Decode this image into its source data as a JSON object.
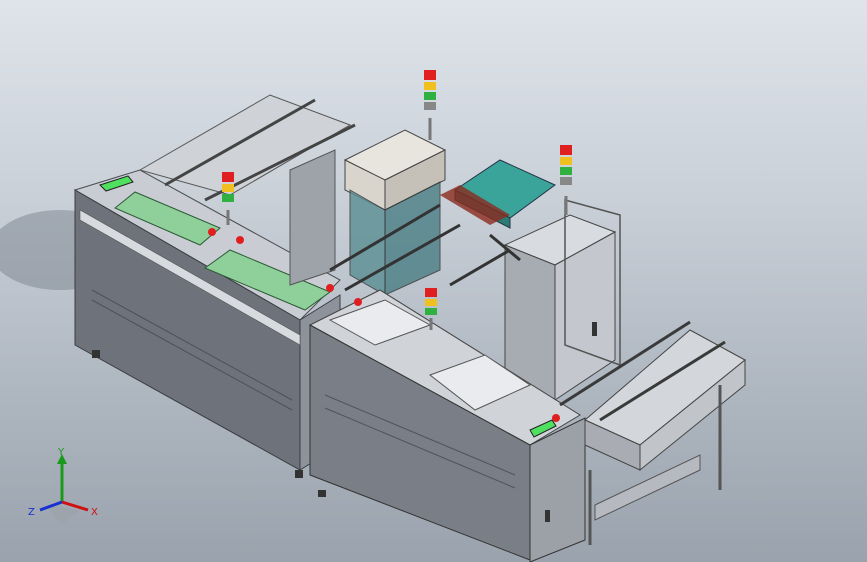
{
  "viewport": {
    "background_top": "#dfe4ea",
    "background_bottom": "#9aa3ad"
  },
  "triad": {
    "x_label": "X",
    "y_label": "Y",
    "z_label": "Z",
    "x_color": "#d01010",
    "y_color": "#1a9a1a",
    "z_color": "#1a2fd0"
  },
  "colors": {
    "frame_front": "#6c7078",
    "frame_side": "#8a8f97",
    "frame_top": "#c7cbd1",
    "rail": "#d5d8dc",
    "green_pcb": "#8fcf9a",
    "teal_pcb": "#3aa39a",
    "signal_red": "#e02020",
    "signal_yellow": "#f0c020",
    "signal_green": "#30b040",
    "screen_green": "#50e060"
  }
}
